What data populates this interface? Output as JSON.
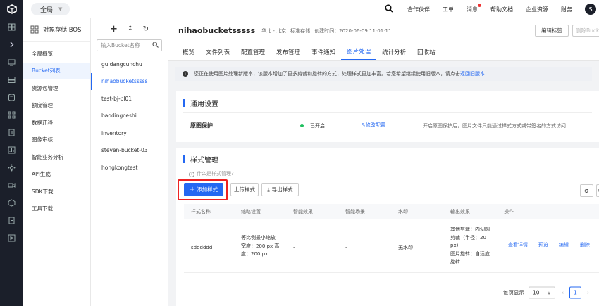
{
  "topbar": {
    "region": "全局",
    "nav": [
      "合作伙伴",
      "工单",
      "消息",
      "帮助文档",
      "企业资源",
      "财务"
    ],
    "avatar": "S"
  },
  "sidebar": {
    "title": "对象存储 BOS",
    "items": [
      "全局概览",
      "Bucket列表",
      "资源包管理",
      "额度管理",
      "数据迁移",
      "图像审核",
      "智能业务分析",
      "API生成",
      "SDK下载",
      "工具下载"
    ],
    "active_index": 1
  },
  "buckets": {
    "search_placeholder": "输入Bucket名称",
    "items": [
      "guidangcunchu",
      "nihaobucketsssss",
      "test-bj-bl01",
      "baodingceshi",
      "inventory",
      "steven-bucket-03",
      "hongkongtest"
    ],
    "active_index": 1
  },
  "header": {
    "title": "nihaobucketsssss",
    "region": "华北 - 北京",
    "storage": "标准存储",
    "created": "创建时间：2020-06-09 11:01:11",
    "edit_tag": "编辑标签",
    "delete": "删除Bucke"
  },
  "tabs": {
    "items": [
      "概览",
      "文件列表",
      "配置管理",
      "发布管理",
      "事件通知",
      "图片处理",
      "统计分析",
      "回收站"
    ],
    "active_index": 5
  },
  "notice": {
    "text": "您正在使用图片处理新版本，该版本增加了更多剪裁和旋转的方式，处理样式更加丰富。若您希望继续使用旧版本，请点击",
    "link": "返回旧版本"
  },
  "general": {
    "title": "通用设置",
    "label": "原图保护",
    "status": "已开启",
    "edit": "修改配置",
    "desc": "开启原图保护后，图片文件只能通过样式方式或带签名的方式访问"
  },
  "styles": {
    "title": "样式管理",
    "hint": "什么是样式管理?",
    "add": "添加样式",
    "upload": "上传样式",
    "export": "导出样式",
    "columns": [
      "样式名称",
      "缩略设置",
      "智能效果",
      "智能场景",
      "水印",
      "输出效果",
      "操作"
    ],
    "row": {
      "name": "sdddddd",
      "thumb": [
        "等比例最小缩放",
        "宽度：200 px 高",
        "度：200 px"
      ],
      "smart": "-",
      "scene": "-",
      "watermark": "无水印",
      "output": [
        "其他剪裁：内切圆",
        "剪裁（半径：20",
        "px)",
        "图片旋转：自适应",
        "旋转"
      ],
      "actions": [
        "查看详情",
        "预览",
        "编辑",
        "删除"
      ]
    },
    "pager": {
      "label": "每页显示",
      "size": "10",
      "page": "1"
    }
  },
  "colors": {
    "accent": "#2468f2",
    "dark": "#1b1f2a",
    "highlight": "#e22222",
    "status_ok": "#1fbf5f"
  }
}
